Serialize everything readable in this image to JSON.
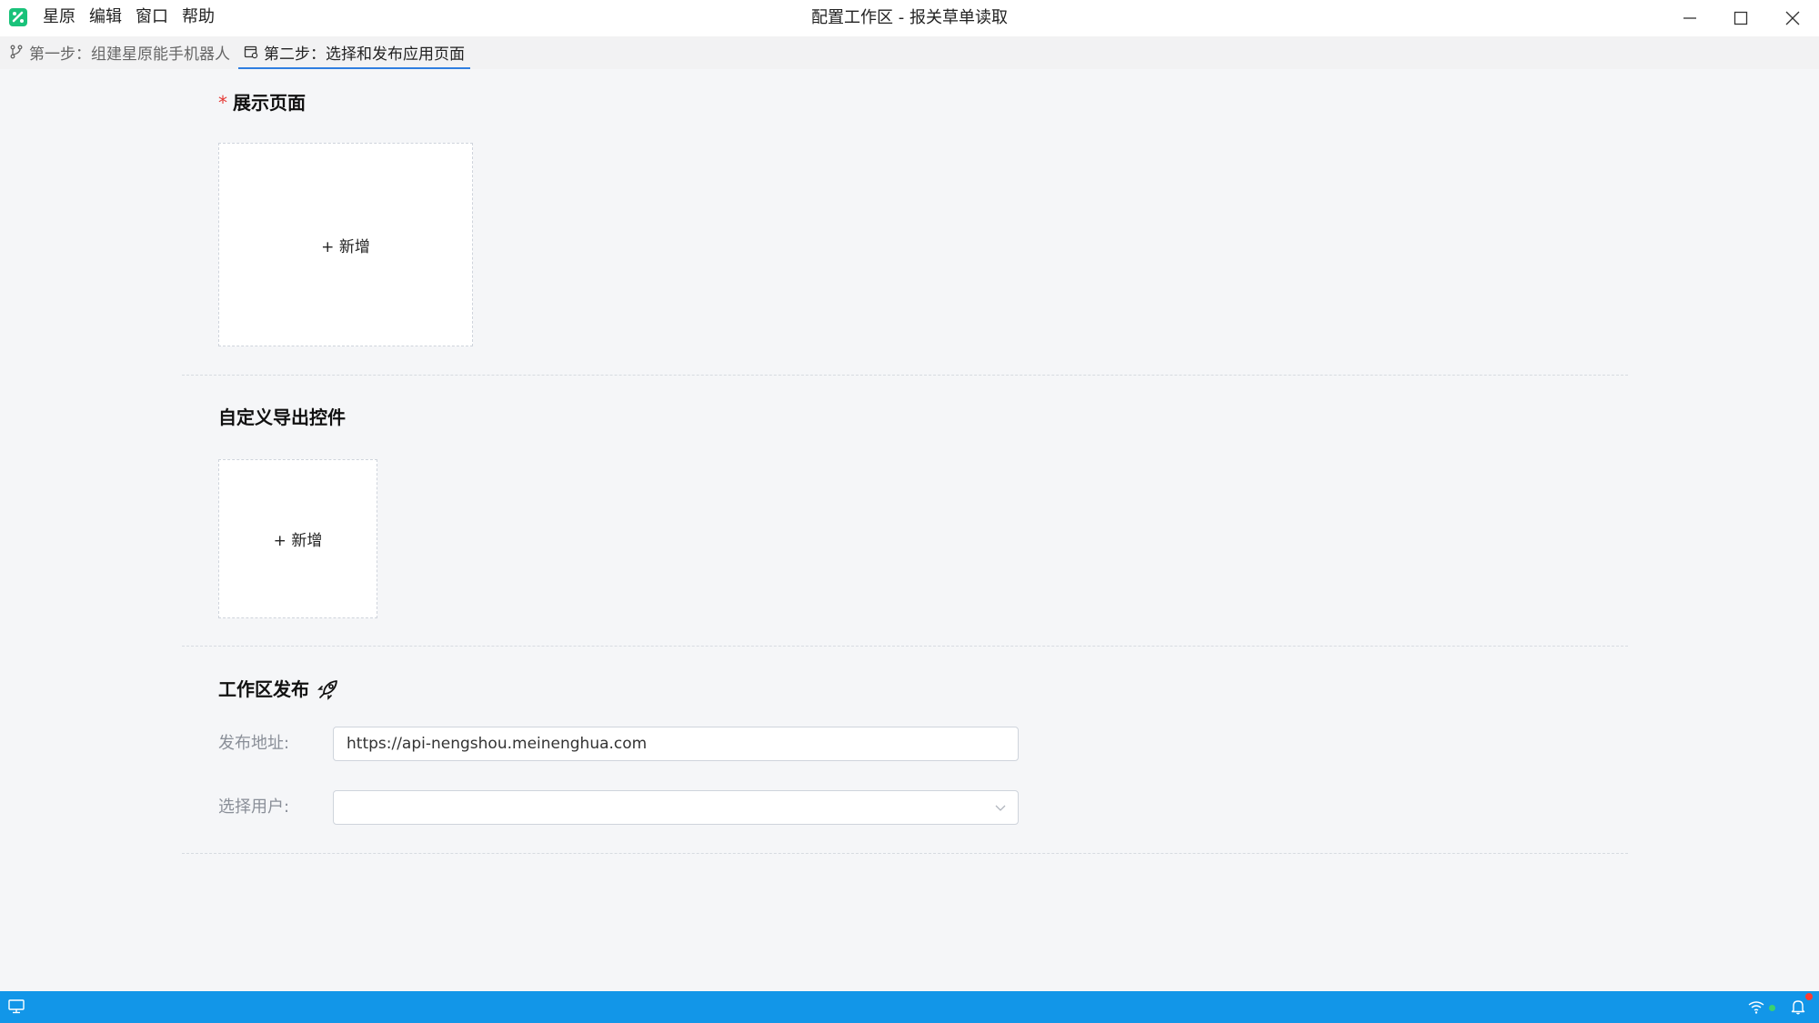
{
  "app": {
    "menu": [
      "星原",
      "编辑",
      "窗口",
      "帮助"
    ],
    "window_title": "配置工作区 - 报关草单读取"
  },
  "tabs": [
    {
      "label": "第一步：组建星原能手机器人",
      "icon": "branch-icon",
      "active": false
    },
    {
      "label": "第二步：选择和发布应用页面",
      "icon": "page-settings-icon",
      "active": true
    }
  ],
  "sections": {
    "display_pages": {
      "required_mark": "*",
      "title": "展示页面",
      "add_label": "+ 新增"
    },
    "custom_export": {
      "title": "自定义导出控件",
      "add_label": "+ 新增"
    },
    "publish": {
      "title": "工作区发布",
      "icon": "rocket-icon",
      "address_label": "发布地址:",
      "address_value": "https://api-nengshou.meinenghua.com",
      "user_label": "选择用户:",
      "user_value": ""
    }
  },
  "statusbar": {
    "left_icon": "monitor-icon",
    "right_icons": [
      "wifi-icon",
      "bell-icon"
    ]
  },
  "colors": {
    "accent": "#2f7ee0",
    "statusbar": "#1296e8",
    "logo": "#19c27a",
    "required": "#e53935"
  }
}
